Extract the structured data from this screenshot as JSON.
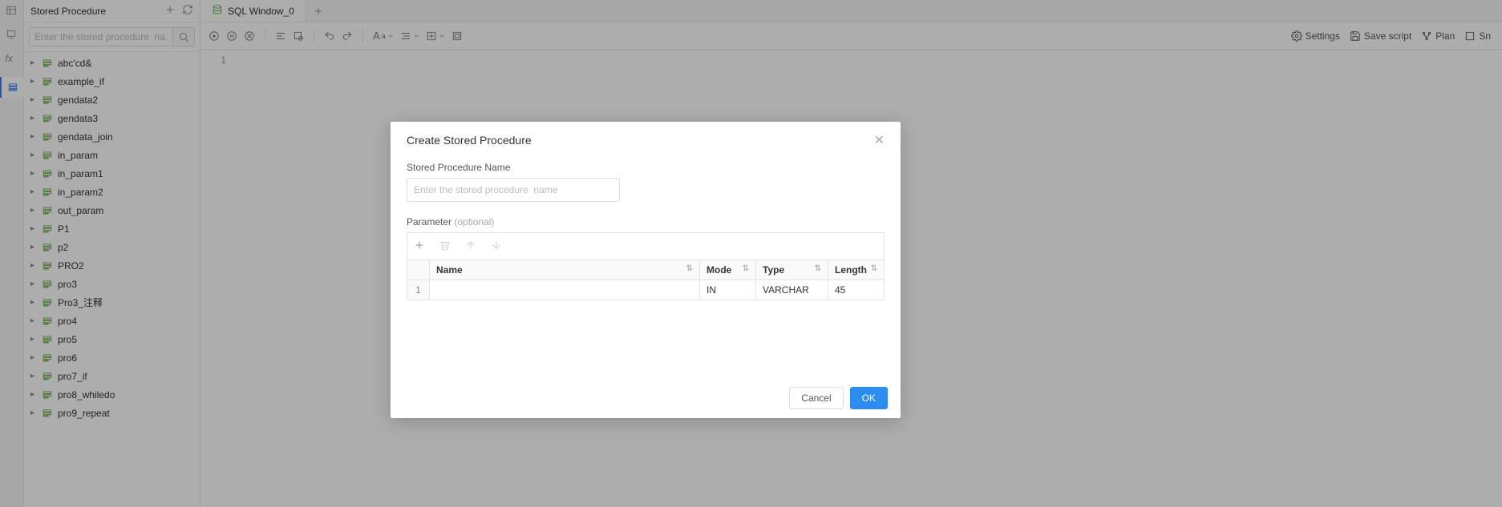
{
  "sidebar": {
    "title": "Stored Procedure",
    "search_placeholder": "Enter the stored procedure  na...",
    "items": [
      {
        "label": "abc'cd&"
      },
      {
        "label": "example_if"
      },
      {
        "label": "gendata2"
      },
      {
        "label": "gendata3"
      },
      {
        "label": "gendata_join"
      },
      {
        "label": "in_param"
      },
      {
        "label": "in_param1"
      },
      {
        "label": "in_param2"
      },
      {
        "label": "out_param"
      },
      {
        "label": "P1"
      },
      {
        "label": "p2"
      },
      {
        "label": "PRO2"
      },
      {
        "label": "pro3"
      },
      {
        "label": "Pro3_注释"
      },
      {
        "label": "pro4"
      },
      {
        "label": "pro5"
      },
      {
        "label": "pro6"
      },
      {
        "label": "pro7_if"
      },
      {
        "label": "pro8_whiledo"
      },
      {
        "label": "pro9_repeat"
      }
    ]
  },
  "tabs": {
    "active": {
      "label": "SQL Window_0"
    }
  },
  "toolbar_right": {
    "settings": "Settings",
    "save_script": "Save script",
    "plan": "Plan",
    "snippet": "Sn"
  },
  "editor": {
    "line1": "1"
  },
  "modal": {
    "title": "Create Stored Procedure",
    "name_label": "Stored Procedure Name",
    "name_placeholder": "Enter the stored procedure  name",
    "param_label": "Parameter",
    "param_optional": "(optional)",
    "table": {
      "headers": {
        "name": "Name",
        "mode": "Mode",
        "type": "Type",
        "length": "Length"
      },
      "rows": [
        {
          "num": "1",
          "name": "",
          "mode": "IN",
          "type": "VARCHAR",
          "length": "45"
        }
      ]
    },
    "footer": {
      "cancel": "Cancel",
      "ok": "OK"
    }
  }
}
